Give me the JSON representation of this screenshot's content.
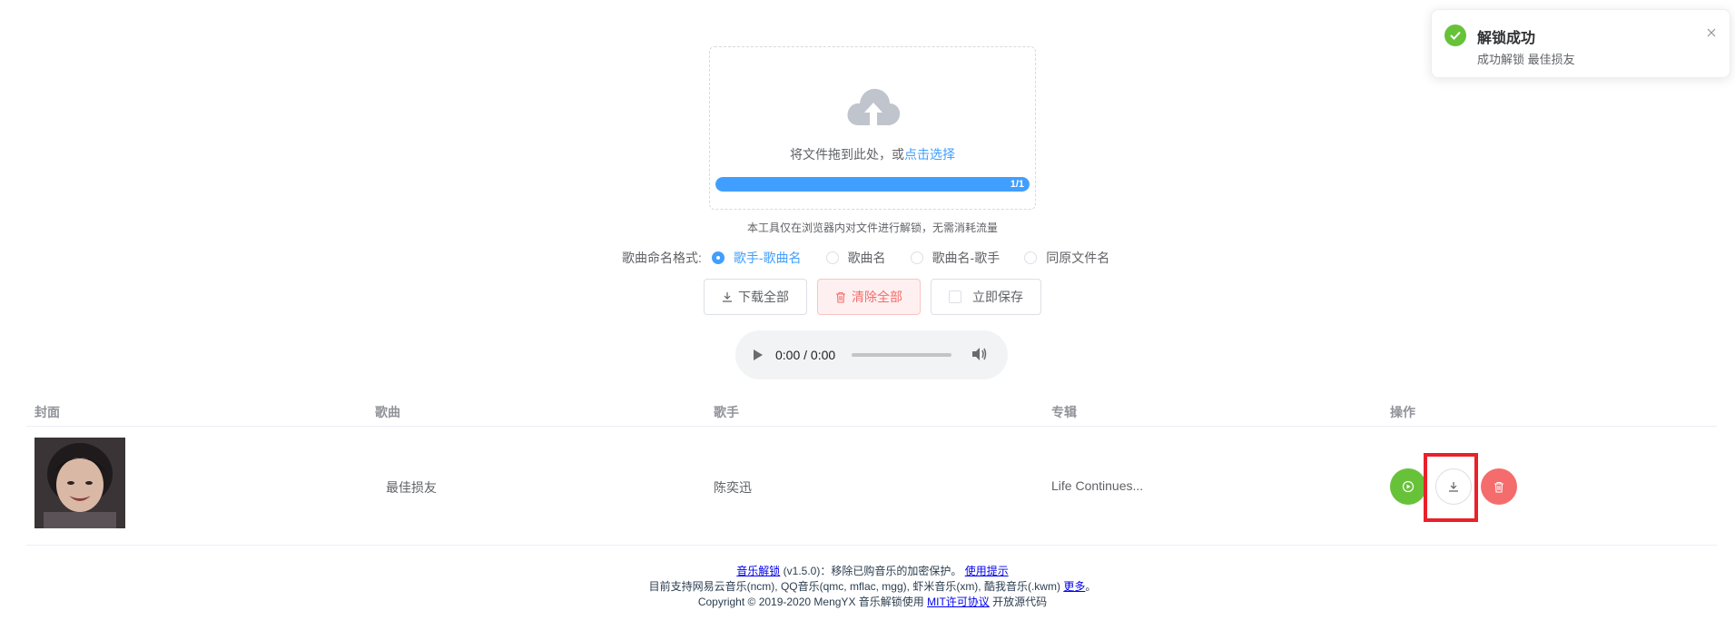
{
  "upload": {
    "drag_text": "将文件拖到此处，或",
    "select_link": "点击选择",
    "progress_label": "1/1",
    "progress": 1.0
  },
  "tip": "本工具仅在浏览器内对文件进行解锁，无需消耗流量",
  "naming": {
    "label": "歌曲命名格式:",
    "options": [
      "歌手-歌曲名",
      "歌曲名",
      "歌曲名-歌手",
      "同原文件名"
    ],
    "selected": "歌手-歌曲名"
  },
  "actions": {
    "download_all": "下载全部",
    "clear_all": "清除全部",
    "save_now": "立即保存"
  },
  "audio": {
    "time": "0:00 / 0:00"
  },
  "table": {
    "headers": [
      "封面",
      "歌曲",
      "歌手",
      "专辑",
      "操作"
    ],
    "rows": [
      {
        "song": "最佳损友",
        "artist": "陈奕迅",
        "album": "Life Continues..."
      }
    ]
  },
  "footer": {
    "line1_link": "音乐解锁",
    "line1_text": "(v1.5.0)：移除已购音乐的加密保护。",
    "line1_link2": "使用提示",
    "line2_text": "目前支持网易云音乐(ncm), QQ音乐(qmc, mflac, mgg), 虾米音乐(xm), 酷我音乐(.kwm)",
    "line2_link": "更多",
    "line2_end": "。",
    "line3_text": "Copyright © 2019-2020 MengYX 音乐解锁使用",
    "line3_link": "MIT许可协议",
    "line3_end": "开放源代码"
  },
  "notification": {
    "title": "解锁成功",
    "message": "成功解锁 最佳损友"
  },
  "colors": {
    "primary": "#409eff",
    "success": "#67c23a",
    "danger": "#f56c6c",
    "highlight": "#e8212a"
  }
}
